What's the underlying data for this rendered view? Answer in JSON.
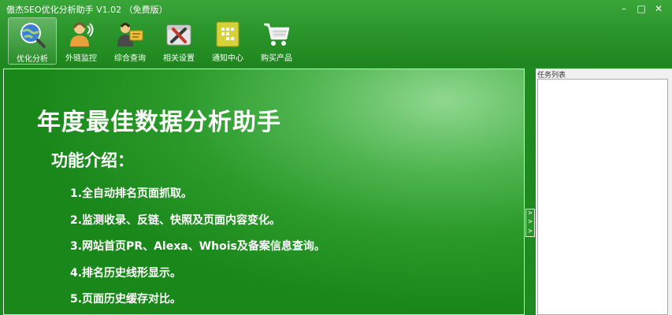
{
  "window": {
    "title": "傲杰SEO优化分析助手 V1.02 （免费版）",
    "controls": {
      "minimize": "–",
      "maximize": "□",
      "close": "✕"
    }
  },
  "toolbar": {
    "items": [
      {
        "label": "优化分析",
        "icon": "globe-search-icon",
        "active": true
      },
      {
        "label": "外链监控",
        "icon": "headset-user-icon",
        "active": false
      },
      {
        "label": "综合查询",
        "icon": "user-card-icon",
        "active": false
      },
      {
        "label": "相关设置",
        "icon": "tools-icon",
        "active": false
      },
      {
        "label": "通知中心",
        "icon": "notice-board-icon",
        "active": false
      },
      {
        "label": "购买产品",
        "icon": "shopping-cart-icon",
        "active": false
      }
    ]
  },
  "banner": {
    "headline": "年度最佳数据分析助手",
    "subhead": "功能介绍：",
    "features": [
      "1.全自动排名页面抓取。",
      "2.监测收录、反链、快照及页面内容变化。",
      "3.网站首页PR、Alexa、Whois及备案信息查询。",
      "4.排名历史线形显示。",
      "5.页面历史缓存对比。"
    ]
  },
  "collapse": {
    "arrows": [
      ">",
      ">",
      ">"
    ]
  },
  "task_panel": {
    "title": "任务列表"
  },
  "colors": {
    "brand_green": "#2b962b",
    "text": "#ffffff"
  }
}
